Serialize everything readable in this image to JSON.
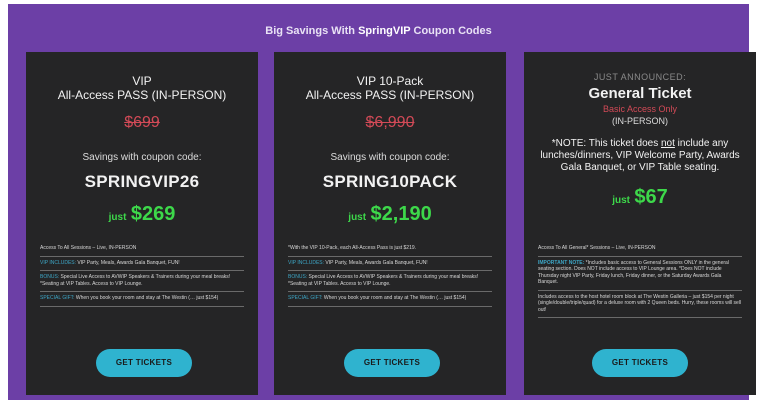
{
  "banner": {
    "prefix": "Big Savings With ",
    "brand": "SpringVIP",
    "suffix": " Coupon Codes"
  },
  "cards": [
    {
      "title_line1": "VIP",
      "title_line2": "All-Access PASS (IN-PERSON)",
      "old_price": "$699",
      "savings_label": "Savings with coupon code:",
      "code": "SPRINGVIP26",
      "just": "just",
      "price": "$269",
      "lines": [
        {
          "lead": "",
          "text": "Access To All Sessions – Live, IN-PERSON"
        },
        {
          "lead": "VIP INCLUDES:",
          "text": " VIP Party, Meals, Awards Gala Banquet, FUN!"
        },
        {
          "lead": "BONUS:",
          "text": " Special Live Access to AVWIP Speakers & Trainers during your meal breaks! *Seating at VIP Tables. Access to VIP Lounge."
        },
        {
          "lead": "SPECIAL GIFT:",
          "text": " When you book your room and stay at The Westin (… just $154)"
        }
      ],
      "button": "GET TICKETS"
    },
    {
      "title_line1": "VIP 10-Pack",
      "title_line2": "All-Access PASS (IN-PERSON)",
      "old_price": "$6,990",
      "savings_label": "Savings with coupon code:",
      "code": "SPRING10PACK",
      "just": "just",
      "price": "$2,190",
      "lines": [
        {
          "lead": "",
          "text": "*With the VIP 10-Pack, each All-Access Pass is just $219."
        },
        {
          "lead": "VIP INCLUDES:",
          "text": " VIP Party, Meals, Awards Gala Banquet, FUN!"
        },
        {
          "lead": "BONUS:",
          "text": " Special Live Access to AVWIP Speakers & Trainers during your meal breaks! *Seating at VIP Tables. Access to VIP Lounge."
        },
        {
          "lead": "SPECIAL GIFT:",
          "text": " When you book your room and stay at The Westin (… just $154)"
        }
      ],
      "button": "GET TICKETS"
    },
    {
      "announce": "JUST ANNOUNCED:",
      "title": "General Ticket",
      "basic": "Basic Access Only",
      "inperson": "(IN-PERSON)",
      "note_a": "*NOTE: This ticket does ",
      "note_not": "not",
      "note_b": " include any lunches/dinners, VIP Welcome Party, Awards Gala Banquet, or VIP Table seating.",
      "just": "just",
      "price": "$67",
      "lines": [
        {
          "lead": "",
          "text": "Access To All General* Sessions – Live, IN-PERSON"
        },
        {
          "lead": "IMPORTANT NOTE:",
          "text": " *Includes basic access to General Sessions ONLY in the general seating section. Does NOT include access to VIP Lounge area. *Does NOT include Thursday night VIP Party, Friday lunch, Friday dinner, or the Saturday Awards Gala Banquet."
        },
        {
          "lead": "",
          "text": "Includes access to the host hotel room block at The Westin Galleria – just $154 per night (single/double/triple/quad) for a deluxe room with 2 Queen beds. Hurry, these rooms will sell out!"
        }
      ],
      "button": "GET TICKETS"
    }
  ]
}
